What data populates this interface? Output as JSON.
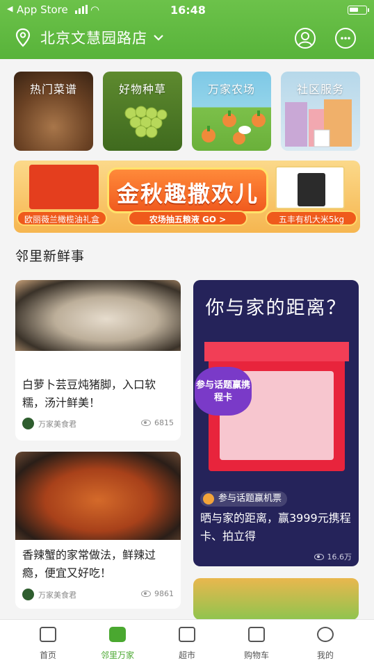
{
  "status_bar": {
    "carrier": "App Store",
    "time": "16:48"
  },
  "header": {
    "store_name": "北京文慧园路店"
  },
  "categories": [
    {
      "label": "热门菜谱"
    },
    {
      "label": "好物种草"
    },
    {
      "label": "万家农场"
    },
    {
      "label": "社区服务"
    }
  ],
  "banner": {
    "title": "金秋趣撒欢儿",
    "left_label": "欧丽薇兰橄榄油礼盒",
    "center_label": "农场抽五粮液 GO >",
    "right_label": "五丰有机大米5kg"
  },
  "section": {
    "title": "邻里新鲜事"
  },
  "feed": [
    {
      "title": "白萝卜芸豆炖猪脚，入口软糯，汤汁鲜美！",
      "author": "万家美食君",
      "views": "6815"
    },
    {
      "title": "香辣蟹的家常做法，鲜辣过瘾，便宜又好吃！",
      "author": "万家美食君",
      "views": "9861"
    },
    {
      "poster_title": "你与家的距离？",
      "poster_badge": "参与话题赢携程卡",
      "tag": "参与话题赢机票",
      "title": "晒与家的距离，赢3999元携程卡、拍立得",
      "views": "16.6万"
    }
  ],
  "tabs": [
    {
      "label": "首页"
    },
    {
      "label": "邻里万家"
    },
    {
      "label": "超市"
    },
    {
      "label": "购物车"
    },
    {
      "label": "我的"
    }
  ],
  "colors": {
    "brand_green": "#58b33a",
    "active_tab": "#4aa830"
  }
}
